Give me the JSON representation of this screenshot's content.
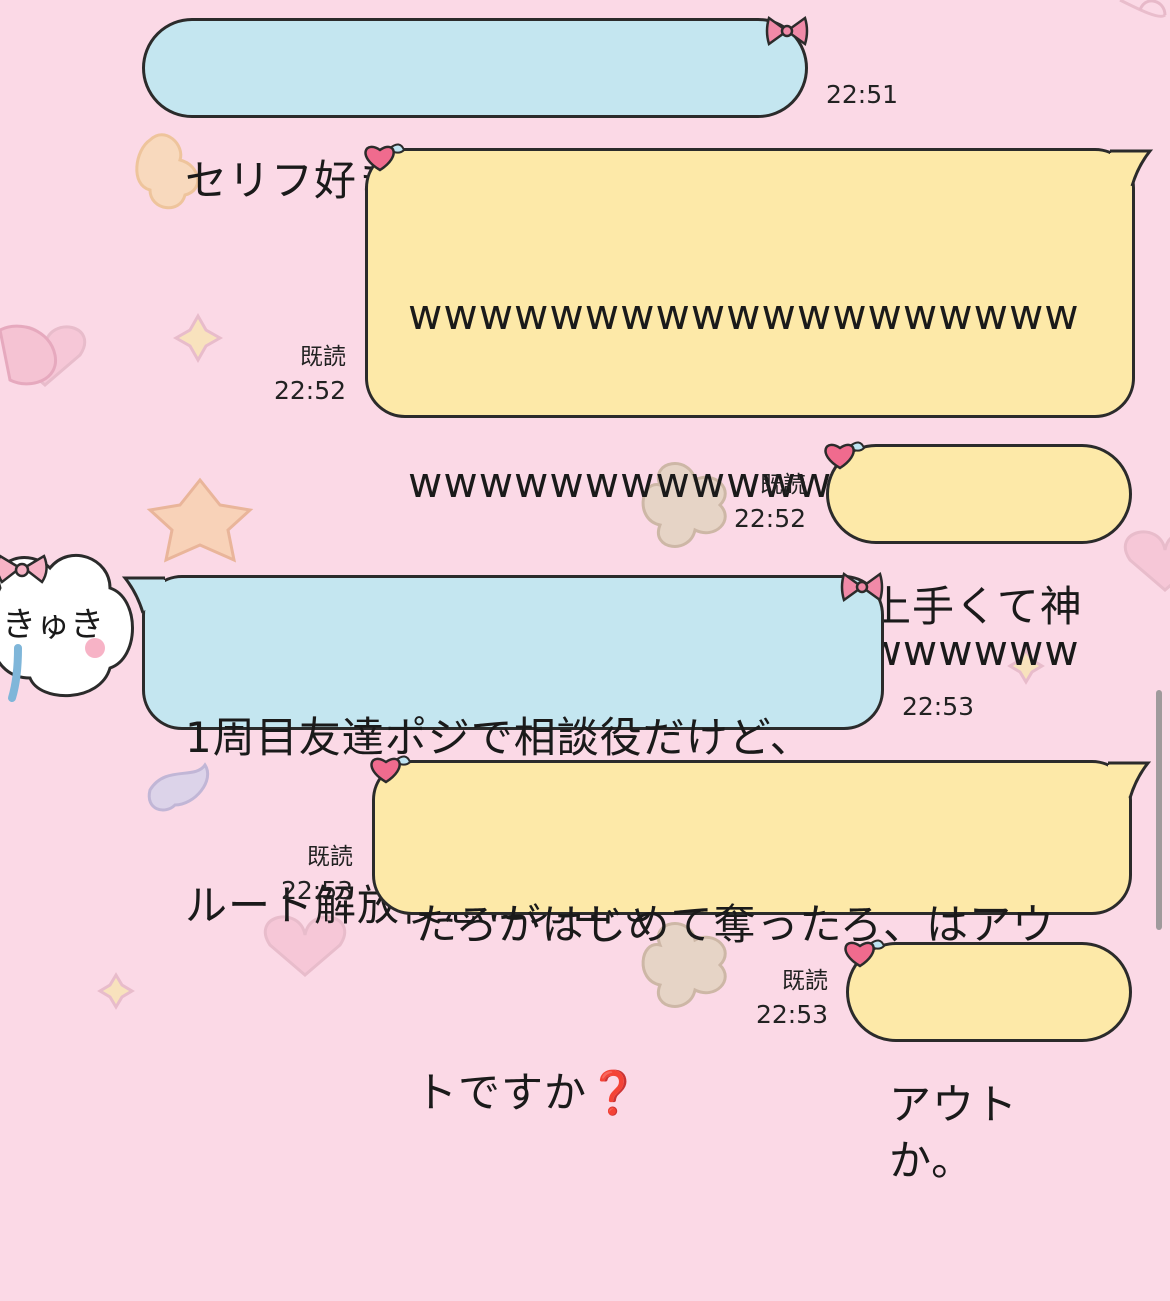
{
  "messages": [
    {
      "side": "in",
      "text": "セリフ好きなの変えられます",
      "time": "22:51",
      "read": ""
    },
    {
      "side": "out",
      "text": "wwwwwwwwwwwwwwwwwwwwwwwwwwwwwwwwwwwwwwwwwwwwwwwwwwwwwwwwwwwwwwwwwwwwwww",
      "lines": [
        "wwwwwwwwwwwwwwwwwww",
        "wwwwwwwwwwwwwwwwwww",
        "wwwwwwwwwwwwwwwwwww",
        "wwwwwww"
      ],
      "time": "22:52",
      "read": "既読"
    },
    {
      "side": "out",
      "text": "上手くて神",
      "time": "22:52",
      "read": "既読"
    },
    {
      "side": "in",
      "lines": [
        "1周目友達ポジで相談役だけど、",
        "ルート解放後急に男出る"
      ],
      "time": "22:53",
      "read": ""
    },
    {
      "side": "out",
      "lines": [
        "たろがはじめて奪ったろ、はアウ",
        "トですか❓"
      ],
      "time": "22:53",
      "read": "既読"
    },
    {
      "side": "out",
      "text": "アウトか。",
      "time": "22:53",
      "read": "既読"
    }
  ],
  "avatar_text": "きゅき",
  "colors": {
    "background": "#fbd9e6",
    "incoming_bubble": "#c4e6f0",
    "outgoing_bubble": "#fde9a8",
    "question_mark": "#d8232a"
  }
}
